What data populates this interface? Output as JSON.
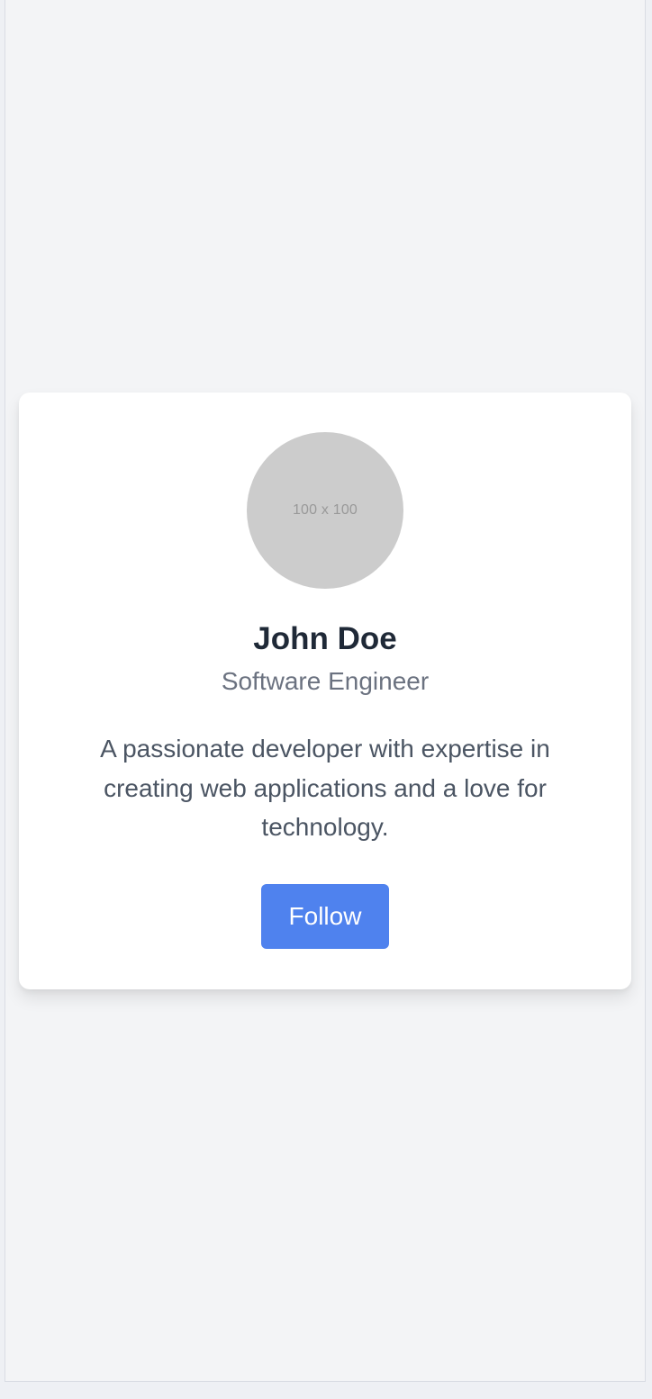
{
  "profile": {
    "avatar_placeholder": "100 x 100",
    "name": "John Doe",
    "title": "Software Engineer",
    "bio": "A passionate developer with expertise in creating web applications and a love for technology.",
    "follow_label": "Follow"
  },
  "colors": {
    "page_background": "#f3f4f6",
    "card_background": "#ffffff",
    "avatar_background": "#cccccc",
    "name_text": "#1f2937",
    "title_text": "#6b7280",
    "bio_text": "#4b5563",
    "button_background": "#4f82ee",
    "button_text": "#ffffff"
  }
}
